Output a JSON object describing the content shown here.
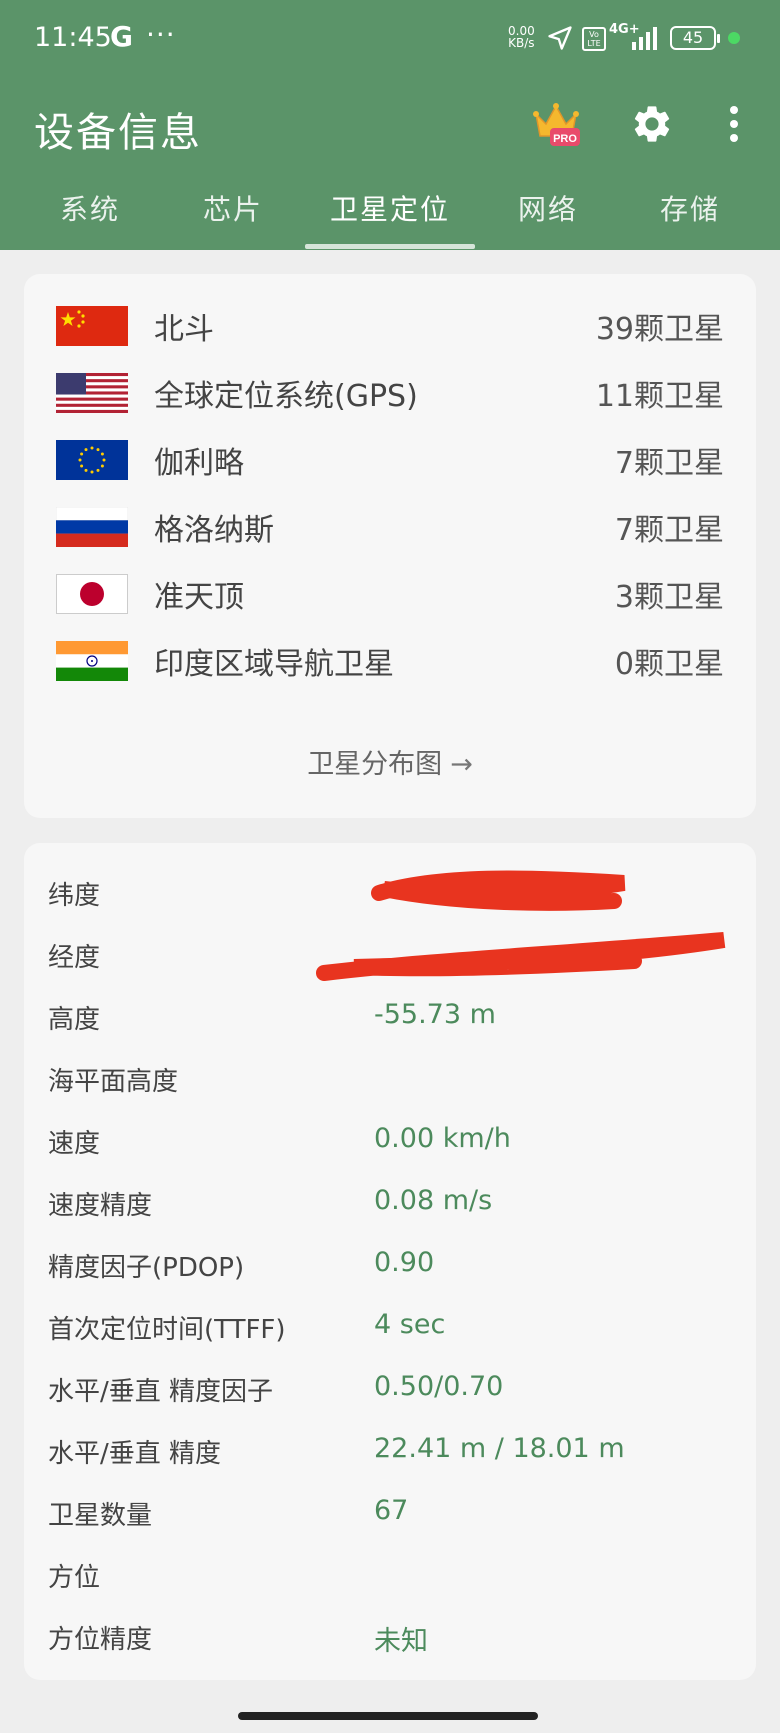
{
  "status_bar": {
    "time": "11:45",
    "g_label": "G",
    "dots": "···",
    "net_speed_top": "0.00",
    "net_speed_bottom": "KB/s",
    "volte": "Vo LTE",
    "network": "4G+",
    "battery": "45"
  },
  "app": {
    "title": "设备信息",
    "pro_badge": "PRO"
  },
  "tabs": [
    {
      "label": "系统",
      "active": false
    },
    {
      "label": "芯片",
      "active": false
    },
    {
      "label": "卫星定位",
      "active": true
    },
    {
      "label": "网络",
      "active": false
    },
    {
      "label": "存储",
      "active": false
    }
  ],
  "gnss": [
    {
      "name": "北斗",
      "count": "39颗卫星",
      "flag": "china"
    },
    {
      "name": "全球定位系统(GPS)",
      "count": "11颗卫星",
      "flag": "usa"
    },
    {
      "name": "伽利略",
      "count": "7颗卫星",
      "flag": "eu"
    },
    {
      "name": "格洛纳斯",
      "count": "7颗卫星",
      "flag": "russia"
    },
    {
      "name": "准天顶",
      "count": "3颗卫星",
      "flag": "japan"
    },
    {
      "name": "印度区域导航卫星",
      "count": "0颗卫星",
      "flag": "india"
    }
  ],
  "satellite_map_link": "卫星分布图",
  "location_info": [
    {
      "label": "纬度",
      "value": ""
    },
    {
      "label": "经度",
      "value": ""
    },
    {
      "label": "高度",
      "value": "-55.73 m"
    },
    {
      "label": "海平面高度",
      "value": ""
    },
    {
      "label": "速度",
      "value": "0.00 km/h"
    },
    {
      "label": "速度精度",
      "value": "0.08 m/s"
    },
    {
      "label": "精度因子(PDOP)",
      "value": "0.90"
    },
    {
      "label": "首次定位时间(TTFF)",
      "value": "4 sec"
    },
    {
      "label": "水平/垂直 精度因子",
      "value": "0.50/0.70"
    },
    {
      "label": "水平/垂直 精度",
      "value": "22.41 m / 18.01 m"
    },
    {
      "label": "卫星数量",
      "value": "67"
    },
    {
      "label": "方位",
      "value": ""
    },
    {
      "label": "方位精度",
      "value": "未知"
    }
  ],
  "colors": {
    "header_bg": "#5b9469",
    "value_green": "#4c8a5c",
    "redaction_red": "#e8341f",
    "page_bg": "#eeeeee",
    "card_bg": "#f7f7f7"
  }
}
